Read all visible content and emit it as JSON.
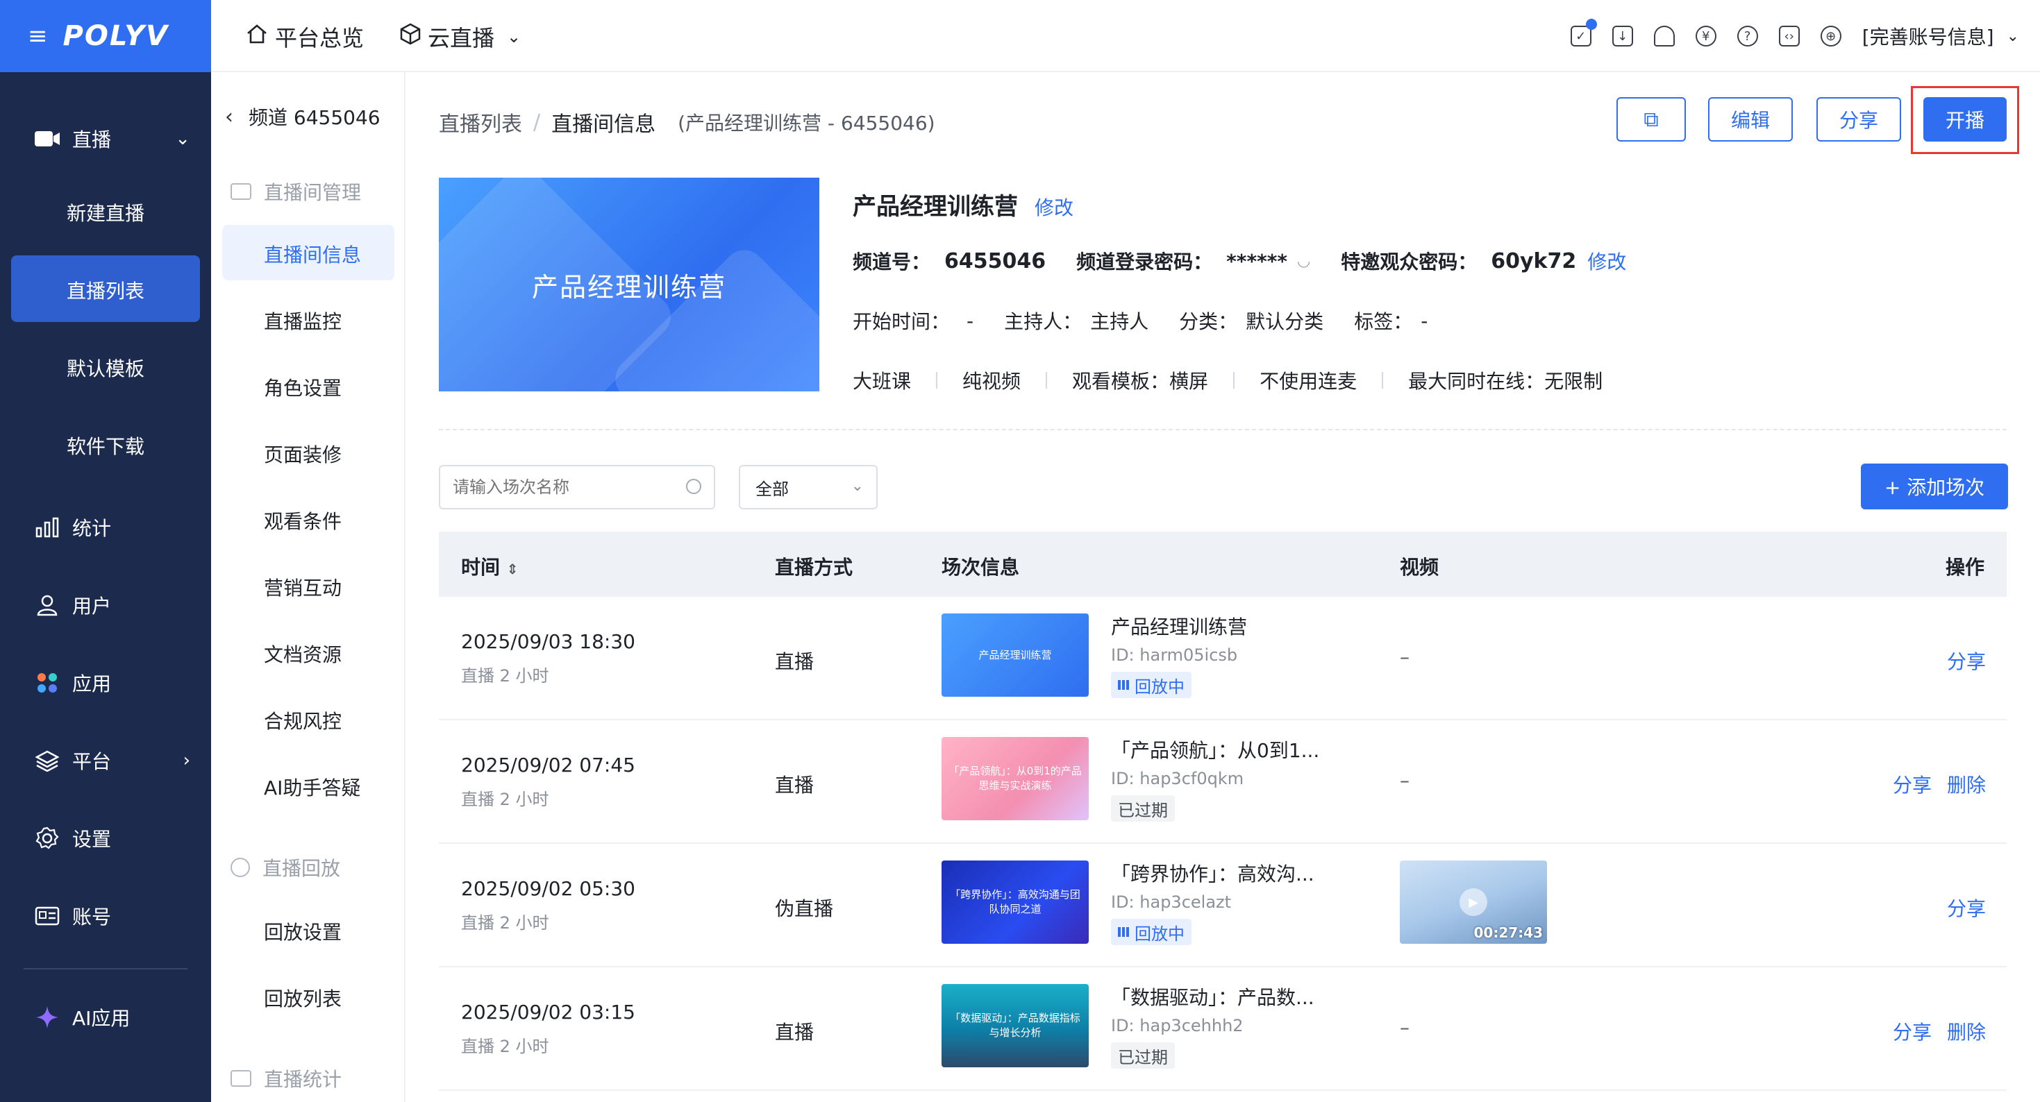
{
  "app": {
    "logo": "POLYV",
    "menu_icon": "≡"
  },
  "sidebar": {
    "items": [
      {
        "label": "直播",
        "icon": "video-icon"
      },
      {
        "label": "新建直播"
      },
      {
        "label": "直播列表"
      },
      {
        "label": "默认模板"
      },
      {
        "label": "软件下载"
      },
      {
        "label": "统计",
        "icon": "bar-chart-icon"
      },
      {
        "label": "用户",
        "icon": "user-icon"
      },
      {
        "label": "应用",
        "icon": "apps-icon"
      },
      {
        "label": "平台",
        "icon": "layers-icon"
      },
      {
        "label": "设置",
        "icon": "gear-icon"
      },
      {
        "label": "账号",
        "icon": "id-card-icon"
      },
      {
        "label": "AI应用",
        "icon": "sparkle-icon"
      }
    ]
  },
  "topbar": {
    "overview": "平台总览",
    "cloud_live": "云直播",
    "account": "[完善账号信息]"
  },
  "submenu": {
    "channel": "频道 6455046",
    "group1": "直播间管理",
    "items1": [
      "直播间信息",
      "直播监控",
      "角色设置",
      "页面装修",
      "观看条件",
      "营销互动",
      "文档资源",
      "合规风控",
      "AI助手答疑"
    ],
    "group2": "直播回放",
    "items2": [
      "回放设置",
      "回放列表"
    ],
    "group3": "直播统计"
  },
  "breadcrumb": {
    "list": "直播列表",
    "sep": "/",
    "current": "直播间信息",
    "extra": "(产品经理训练营 - 6455046)"
  },
  "actions": {
    "copy_icon": "⧉",
    "edit": "编辑",
    "share": "分享",
    "start": "开播"
  },
  "channel": {
    "cover_title": "产品经理训练营",
    "name": "产品经理训练营",
    "edit": "修改",
    "id_label": "频道号：",
    "id": "6455046",
    "pwd_label": "频道登录密码：",
    "pwd": "******",
    "invite_label": "特邀观众密码：",
    "invite": "60yk72",
    "invite_edit": "修改",
    "start_label": "开始时间：",
    "start": "-",
    "host_label": "主持人：",
    "host": "主持人",
    "cat_label": "分类：",
    "cat": "默认分类",
    "tag_label": "标签：",
    "tag": "-",
    "t1": "大班课",
    "t2": "纯视频",
    "t3_label": "观看模板：",
    "t3": "横屏",
    "t4": "不使用连麦",
    "t5_label": "最大同时在线：",
    "t5": "无限制"
  },
  "filters": {
    "search_placeholder": "请输入场次名称",
    "select_value": "全部",
    "add": "+ 添加场次"
  },
  "table": {
    "headers": {
      "time": "时间",
      "mode": "直播方式",
      "info": "场次信息",
      "video": "视频",
      "ops": "操作"
    },
    "rows": [
      {
        "time": "2025/09/03 18:30",
        "dur": "直播 2 小时",
        "mode": "直播",
        "thumb": "产品经理训练营",
        "name": "产品经理训练营",
        "id": "ID: harm05icsb",
        "tag": "回放中",
        "video": "–",
        "ops": [
          "分享"
        ]
      },
      {
        "time": "2025/09/02 07:45",
        "dur": "直播 2 小时",
        "mode": "直播",
        "thumb": "「产品领航」：从0到1的产品思维与实战演练",
        "name": "「产品领航」：从0到1...",
        "id": "ID: hap3cf0qkm",
        "tag": "已过期",
        "video": "–",
        "ops": [
          "分享",
          "删除"
        ]
      },
      {
        "time": "2025/09/02 05:30",
        "dur": "直播 2 小时",
        "mode": "伪直播",
        "thumb": "「跨界协作」：高效沟通与团队协同之道",
        "name": "「跨界协作」：高效沟...",
        "id": "ID: hap3celazt",
        "tag": "回放中",
        "video_duration": "00:27:43",
        "ops": [
          "分享"
        ]
      },
      {
        "time": "2025/09/02 03:15",
        "dur": "直播 2 小时",
        "mode": "直播",
        "thumb": "「数据驱动」：产品数据指标与增长分析",
        "name": "「数据驱动」：产品数...",
        "id": "ID: hap3cehhh2",
        "tag": "已过期",
        "video": "–",
        "ops": [
          "分享",
          "删除"
        ]
      }
    ]
  },
  "colors": {
    "primary": "#2f6ef0",
    "sidebar": "#1c2b4d",
    "highlight": "#e53935"
  }
}
